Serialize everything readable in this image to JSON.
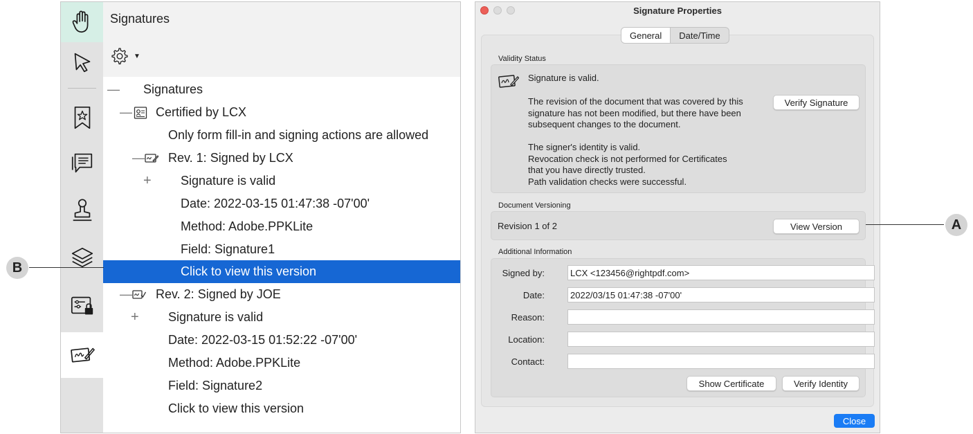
{
  "left_panel": {
    "title": "Signatures",
    "rail": [
      "hand-tool",
      "select-tool",
      "bookmarks",
      "comments",
      "stamps",
      "layers",
      "form-security",
      "signatures"
    ],
    "tree": {
      "root": "Signatures",
      "certified": "Certified by LCX",
      "certified_note": "Only form fill-in and signing actions are allowed",
      "rev1": {
        "label": "Rev. 1: Signed by LCX",
        "status": "Signature is valid",
        "date": "Date: 2022-03-15 01:47:38 -07'00'",
        "method": "Method: Adobe.PPKLite",
        "field": "Field: Signature1",
        "view": "Click to view this version"
      },
      "rev2": {
        "label": "Rev. 2: Signed by JOE",
        "status": "Signature is valid",
        "date": "Date: 2022-03-15 01:52:22 -07'00'",
        "method": "Method: Adobe.PPKLite",
        "field": "Field: Signature2",
        "view": "Click to view this version"
      }
    }
  },
  "dialog": {
    "title": "Signature Properties",
    "tabs": [
      "General",
      "Date/Time"
    ],
    "validity": {
      "label": "Validity Status",
      "line1": "Signature is valid.",
      "line2a": "The revision of the document that was covered by this",
      "line2b": "signature has not been modified, but there have been",
      "line2c": "subsequent changes to the document.",
      "line3a": "The signer's identity is valid.",
      "line3b": "Revocation check is not performed for Certificates",
      "line3c": "that you have directly trusted.",
      "line3d": "Path validation checks were successful.",
      "verify_signature": "Verify Signature"
    },
    "versioning": {
      "label": "Document Versioning",
      "revision": "Revision 1 of 2",
      "view_version": "View Version"
    },
    "additional": {
      "label": "Additional Information",
      "signed_by_label": "Signed by:",
      "signed_by": "LCX <123456@rightpdf.com>",
      "date_label": "Date:",
      "date": "2022/03/15 01:47:38 -07'00'",
      "reason_label": "Reason:",
      "reason": "",
      "location_label": "Location:",
      "location": "",
      "contact_label": "Contact:",
      "contact": "",
      "show_certificate": "Show Certificate",
      "verify_identity": "Verify Identity"
    },
    "close": "Close"
  },
  "callouts": {
    "a": "A",
    "b": "B"
  },
  "colors": {
    "selection": "#1667d4",
    "close_button": "#1a7cf5",
    "traffic_close": "#ec5f58",
    "active_rail": "#d6efe6"
  }
}
